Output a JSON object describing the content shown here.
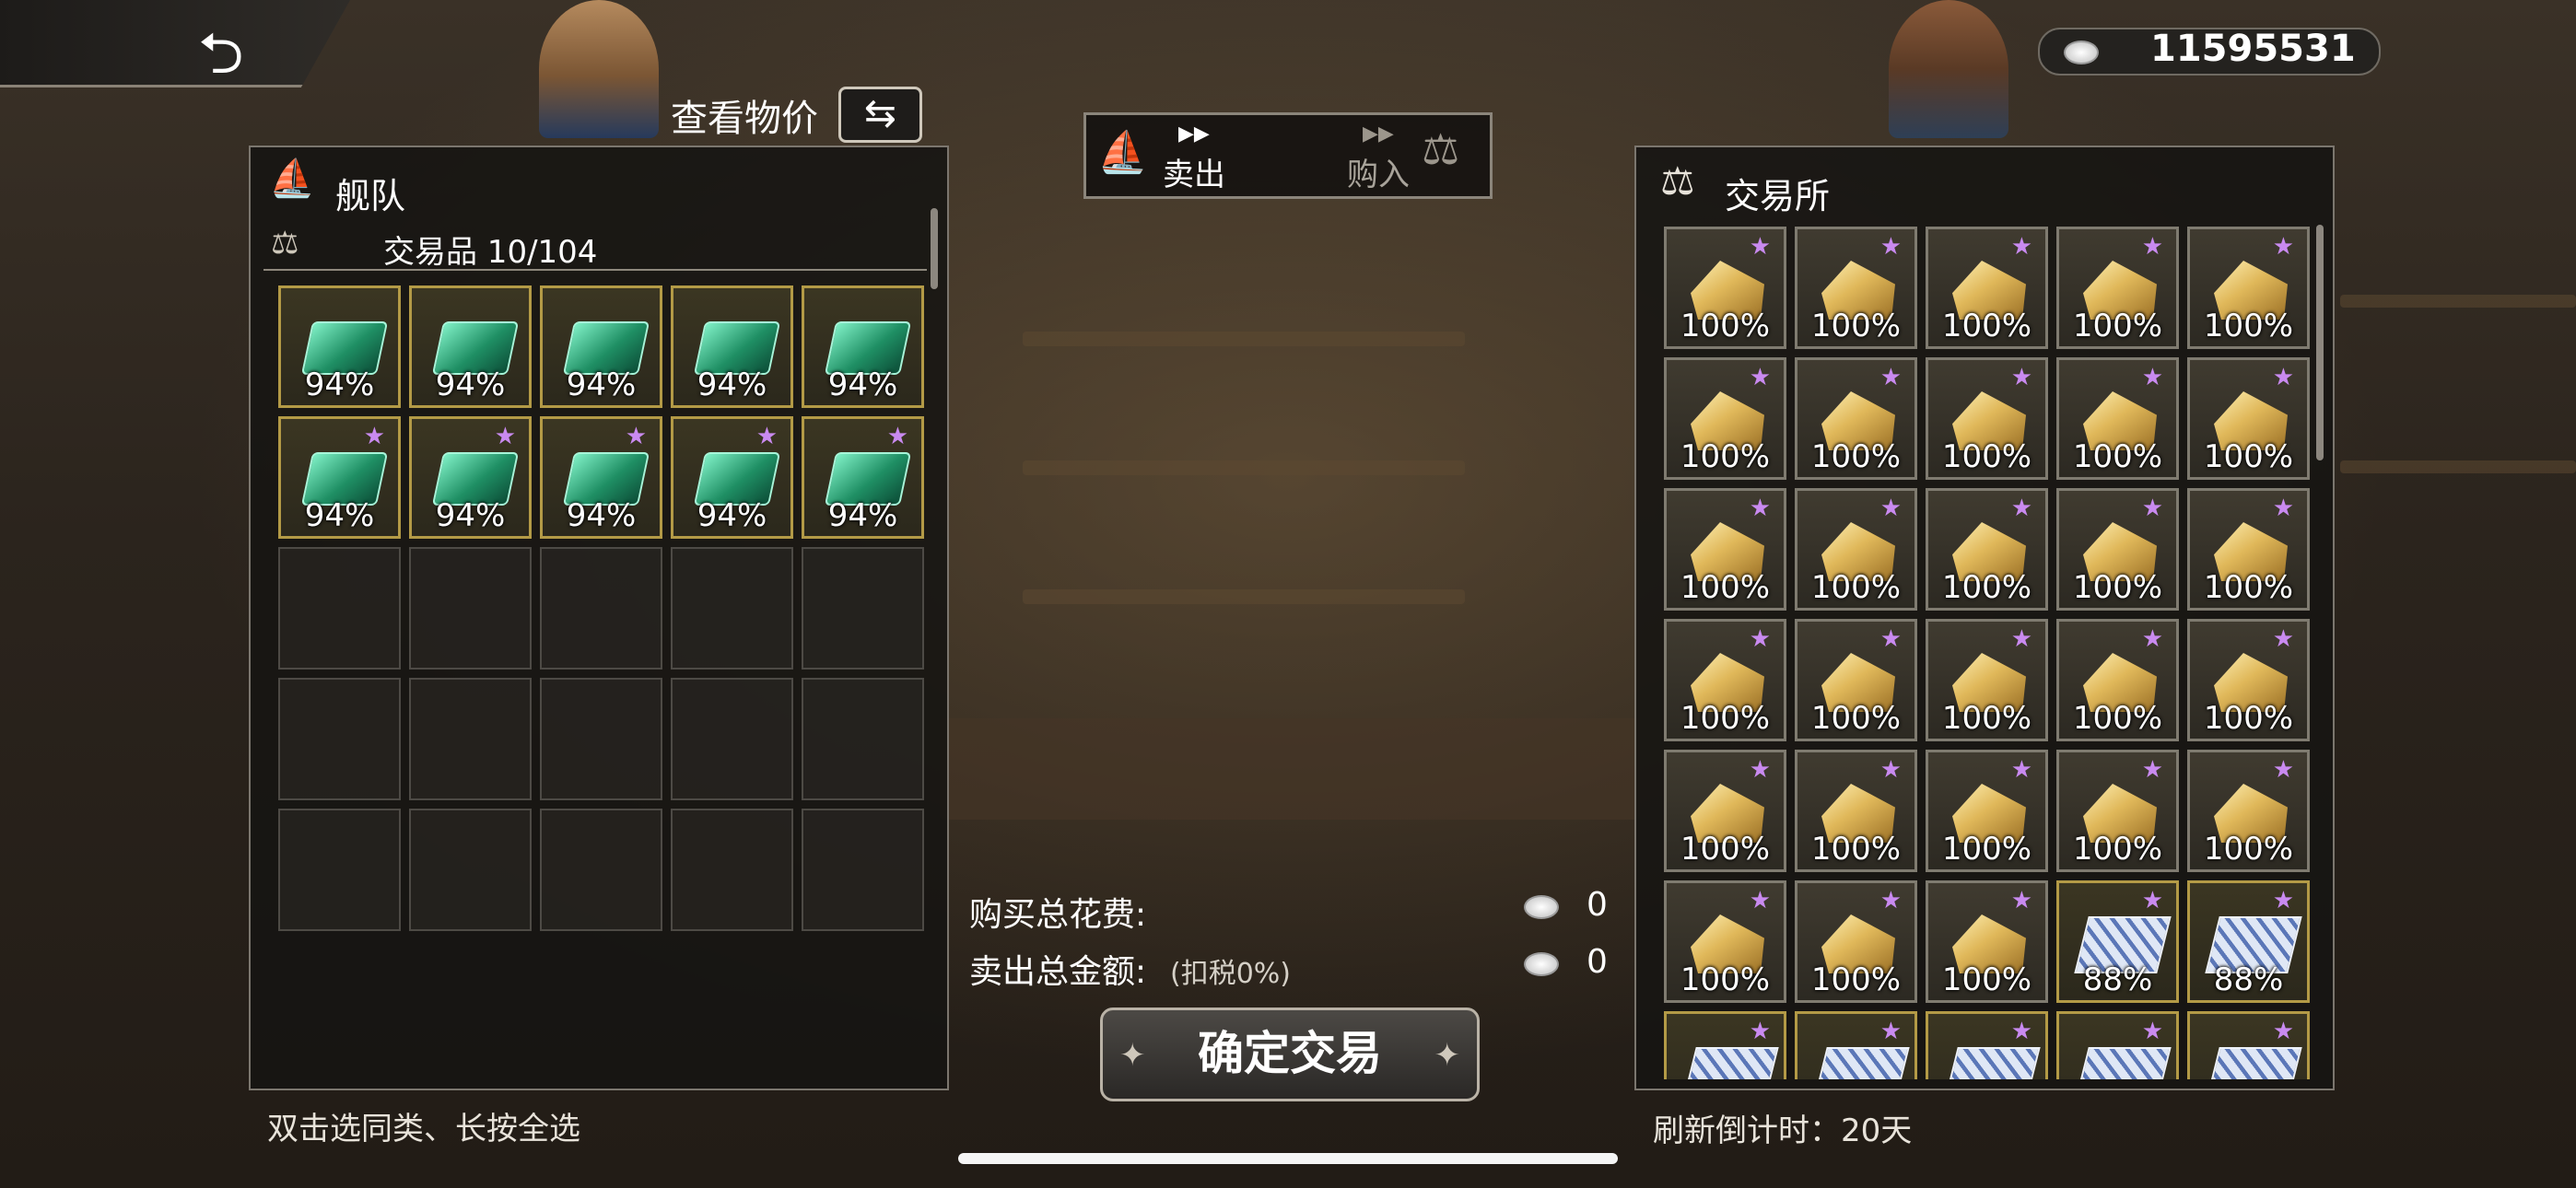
{
  "header": {
    "back_icon": "back-arrow-icon",
    "check_price_label": "查看物价",
    "swap_icon": "swap-arrows-icon",
    "coins_icon": "silver-coins-icon",
    "coins_value": "11595531"
  },
  "mode_toggle": {
    "sell_label": "卖出",
    "buy_label": "购入",
    "ship_icon": "ship-icon",
    "scale_icon": "scale-icon"
  },
  "fleet_panel": {
    "title": "舰队",
    "goods_label": "交易品 10/104",
    "items": [
      {
        "icon": "emerald-icon",
        "percent": "94%",
        "star": false
      },
      {
        "icon": "emerald-icon",
        "percent": "94%",
        "star": false
      },
      {
        "icon": "emerald-icon",
        "percent": "94%",
        "star": false
      },
      {
        "icon": "emerald-icon",
        "percent": "94%",
        "star": false
      },
      {
        "icon": "emerald-icon",
        "percent": "94%",
        "star": false
      },
      {
        "icon": "emerald-icon",
        "percent": "94%",
        "star": true
      },
      {
        "icon": "emerald-icon",
        "percent": "94%",
        "star": true
      },
      {
        "icon": "emerald-icon",
        "percent": "94%",
        "star": true
      },
      {
        "icon": "emerald-icon",
        "percent": "94%",
        "star": true
      },
      {
        "icon": "emerald-icon",
        "percent": "94%",
        "star": true
      }
    ],
    "empty_slots": 15,
    "hint": "双击选同类、长按全选"
  },
  "exchange_panel": {
    "title": "交易所",
    "items": [
      {
        "icon": "gold-ore-icon",
        "percent": "100%"
      },
      {
        "icon": "gold-ore-icon",
        "percent": "100%"
      },
      {
        "icon": "gold-ore-icon",
        "percent": "100%"
      },
      {
        "icon": "gold-ore-icon",
        "percent": "100%"
      },
      {
        "icon": "gold-ore-icon",
        "percent": "100%"
      },
      {
        "icon": "gold-ore-icon",
        "percent": "100%"
      },
      {
        "icon": "gold-ore-icon",
        "percent": "100%"
      },
      {
        "icon": "gold-ore-icon",
        "percent": "100%"
      },
      {
        "icon": "gold-ore-icon",
        "percent": "100%"
      },
      {
        "icon": "gold-ore-icon",
        "percent": "100%"
      },
      {
        "icon": "gold-ore-icon",
        "percent": "100%"
      },
      {
        "icon": "gold-ore-icon",
        "percent": "100%"
      },
      {
        "icon": "gold-ore-icon",
        "percent": "100%"
      },
      {
        "icon": "gold-ore-icon",
        "percent": "100%"
      },
      {
        "icon": "gold-ore-icon",
        "percent": "100%"
      },
      {
        "icon": "gold-ore-icon",
        "percent": "100%"
      },
      {
        "icon": "gold-ore-icon",
        "percent": "100%"
      },
      {
        "icon": "gold-ore-icon",
        "percent": "100%"
      },
      {
        "icon": "gold-ore-icon",
        "percent": "100%"
      },
      {
        "icon": "gold-ore-icon",
        "percent": "100%"
      },
      {
        "icon": "gold-ore-icon",
        "percent": "100%"
      },
      {
        "icon": "gold-ore-icon",
        "percent": "100%"
      },
      {
        "icon": "gold-ore-icon",
        "percent": "100%"
      },
      {
        "icon": "gold-ore-icon",
        "percent": "100%"
      },
      {
        "icon": "gold-ore-icon",
        "percent": "100%"
      },
      {
        "icon": "gold-ore-icon",
        "percent": "100%"
      },
      {
        "icon": "gold-ore-icon",
        "percent": "100%"
      },
      {
        "icon": "gold-ore-icon",
        "percent": "100%"
      },
      {
        "icon": "porcelain-icon",
        "percent": "88%"
      },
      {
        "icon": "porcelain-icon",
        "percent": "88%"
      },
      {
        "icon": "porcelain-icon",
        "percent": ""
      },
      {
        "icon": "porcelain-icon",
        "percent": ""
      },
      {
        "icon": "porcelain-icon",
        "percent": ""
      },
      {
        "icon": "porcelain-icon",
        "percent": ""
      },
      {
        "icon": "porcelain-icon",
        "percent": ""
      }
    ],
    "refresh_label": "刷新倒计时：20天"
  },
  "summary": {
    "buy_total_label": "购买总花费:",
    "buy_total_value": "0",
    "sell_total_label": "卖出总金额:",
    "sell_tax_label": "(扣税0%)",
    "sell_total_value": "0",
    "confirm_label": "确定交易"
  }
}
